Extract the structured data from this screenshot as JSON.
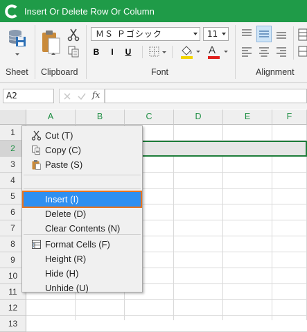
{
  "window": {
    "title": "Insert Or Delete Row Or Column"
  },
  "ribbon": {
    "groups": {
      "sheet": "Sheet",
      "clipboard": "Clipboard",
      "font": "Font",
      "alignment": "Alignment"
    },
    "font_name": "ＭＳ Ｐゴシック",
    "font_size": "11",
    "bold": "B",
    "italic": "I",
    "underline": "U",
    "font_color_letter": "A"
  },
  "formula_bar": {
    "name_box": "A2",
    "fx": "fx",
    "formula": ""
  },
  "grid": {
    "columns": [
      "A",
      "B",
      "C",
      "D",
      "E",
      "F"
    ],
    "rows": [
      "1",
      "2",
      "3",
      "4",
      "5",
      "6",
      "7",
      "8",
      "9",
      "10",
      "11",
      "12",
      "13"
    ],
    "selected_row": "2"
  },
  "context_menu": {
    "items": [
      {
        "label": "Cut (T)",
        "icon": "scissors-icon"
      },
      {
        "label": "Copy (C)",
        "icon": "copy-icon"
      },
      {
        "label": "Paste (S)",
        "icon": "paste-icon"
      },
      {
        "label": "Insert (I)",
        "icon": "",
        "highlighted": true
      },
      {
        "label": "Delete (D)",
        "icon": ""
      },
      {
        "label": "Clear Contents (N)",
        "icon": ""
      },
      {
        "label": "Format Cells (F)",
        "icon": "format-cells-icon"
      },
      {
        "label": "Height (R)",
        "icon": ""
      },
      {
        "label": "Hide (H)",
        "icon": ""
      },
      {
        "label": "Unhide (U)",
        "icon": ""
      }
    ]
  },
  "colors": {
    "title_bar": "#1f9b48",
    "header_text": "#1f8f44",
    "menu_highlight": "#2e8ff0",
    "highlight_border": "#e8731d",
    "selection_border": "#1e7d3a"
  }
}
